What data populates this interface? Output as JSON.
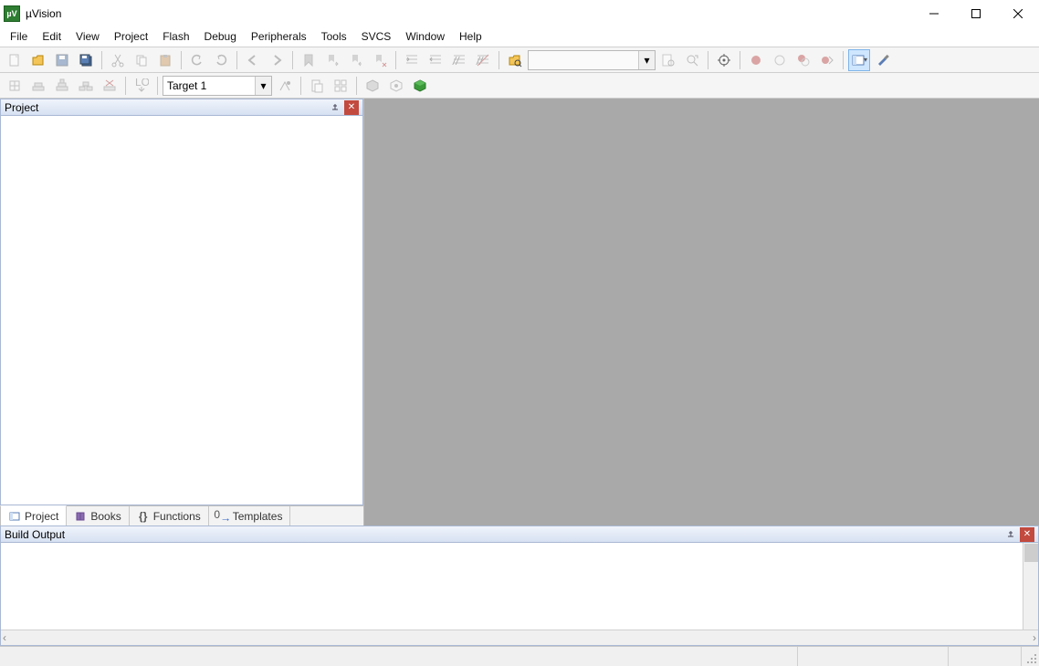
{
  "title": "µVision",
  "menu": [
    "File",
    "Edit",
    "View",
    "Project",
    "Flash",
    "Debug",
    "Peripherals",
    "Tools",
    "SVCS",
    "Window",
    "Help"
  ],
  "toolbar2": {
    "target": "Target 1"
  },
  "panels": {
    "project": "Project",
    "build": "Build Output"
  },
  "tabs": {
    "project": "Project",
    "books": "Books",
    "functions": "Functions",
    "templates": "Templates"
  }
}
